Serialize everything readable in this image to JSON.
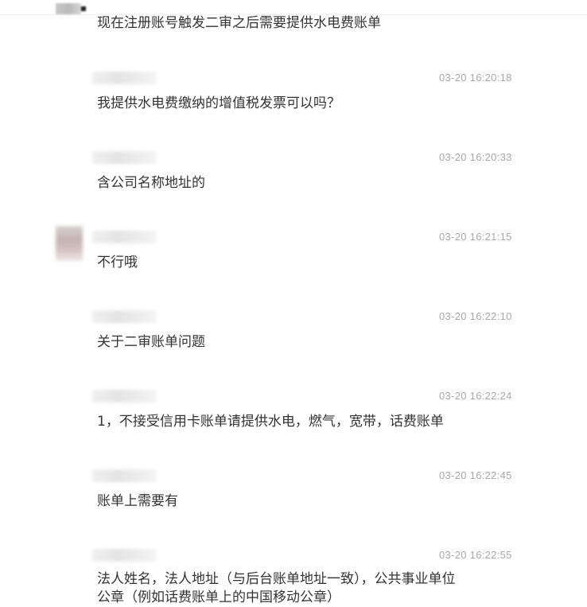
{
  "messages": [
    {
      "time": "",
      "text": "现在注册账号触发二审之后需要提供水电费账单"
    },
    {
      "time": "03-20 16:20:18",
      "text": "我提供水电费缴纳的增值税发票可以吗？"
    },
    {
      "time": "03-20 16:20:33",
      "text": "含公司名称地址的"
    },
    {
      "time": "03-20 16:21:15",
      "text": "不行哦"
    },
    {
      "time": "03-20 16:22:10",
      "text": "关于二审账单问题"
    },
    {
      "time": "03-20 16:22:24",
      "text": "1，不接受信用卡账单请提供水电，燃气，宽带，话费账单"
    },
    {
      "time": "03-20 16:22:45",
      "text": "账单上需要有"
    },
    {
      "time": "03-20 16:22:55",
      "text": "法人姓名，法人地址（与后台账单地址一致），公共事业单位\n公章（例如话费账单上的中国移动公章）"
    }
  ]
}
